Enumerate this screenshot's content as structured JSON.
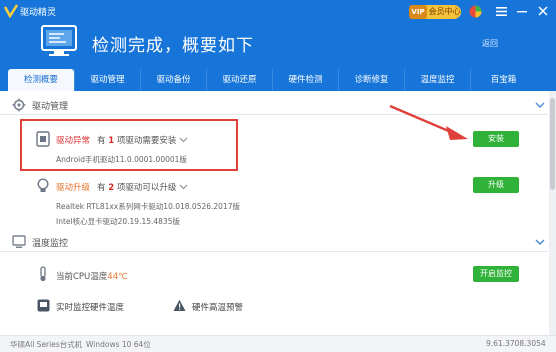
{
  "titlebar": {
    "app_name": "驱动精灵",
    "vip_badge": "VIP",
    "vip_label": "会员中心",
    "icons": [
      "app-logo-icon",
      "vip-icon",
      "color-ball-icon",
      "menu-icon",
      "minimize-icon",
      "close-icon"
    ]
  },
  "header": {
    "title": "检测完成，概要如下",
    "return_link": "返回"
  },
  "tabs": [
    {
      "label": "检测概要",
      "active": true
    },
    {
      "label": "驱动管理"
    },
    {
      "label": "驱动备份"
    },
    {
      "label": "驱动还原"
    },
    {
      "label": "硬件检测"
    },
    {
      "label": "诊断修复"
    },
    {
      "label": "温度监控"
    },
    {
      "label": "百宝箱"
    }
  ],
  "driver_section": {
    "title": "驱动管理",
    "abnormal": {
      "status": "驱动异常",
      "prefix": "有",
      "count": "1",
      "suffix": "项驱动需要安装",
      "detail": "Android手机驱动11.0.0001.00001版",
      "button": "安装"
    },
    "upgrade": {
      "status": "驱动升级",
      "prefix": "有",
      "count": "2",
      "suffix": "项驱动可以升级",
      "details": [
        "Realtek RTL81xx系列网卡驱动10.018.0526.2017版",
        "Intel核心显卡驱动20.19.15.4835版"
      ],
      "button": "升级"
    }
  },
  "temp_section": {
    "title": "温度监控",
    "cpu_label": "当前CPU温度",
    "cpu_value": "44℃",
    "button": "开启监控",
    "feature_realtime": "实时监控硬件温度",
    "feature_warning": "硬件高温预警"
  },
  "footer": {
    "machine": "华硕All Series台式机",
    "os": "Windows 10 64位",
    "version": "9.61.3708.3054"
  },
  "colors": {
    "brand_blue": "#1775d9",
    "alert_red": "#e23535",
    "upgrade_orange": "#e8712a",
    "button_green": "#2fb237"
  }
}
